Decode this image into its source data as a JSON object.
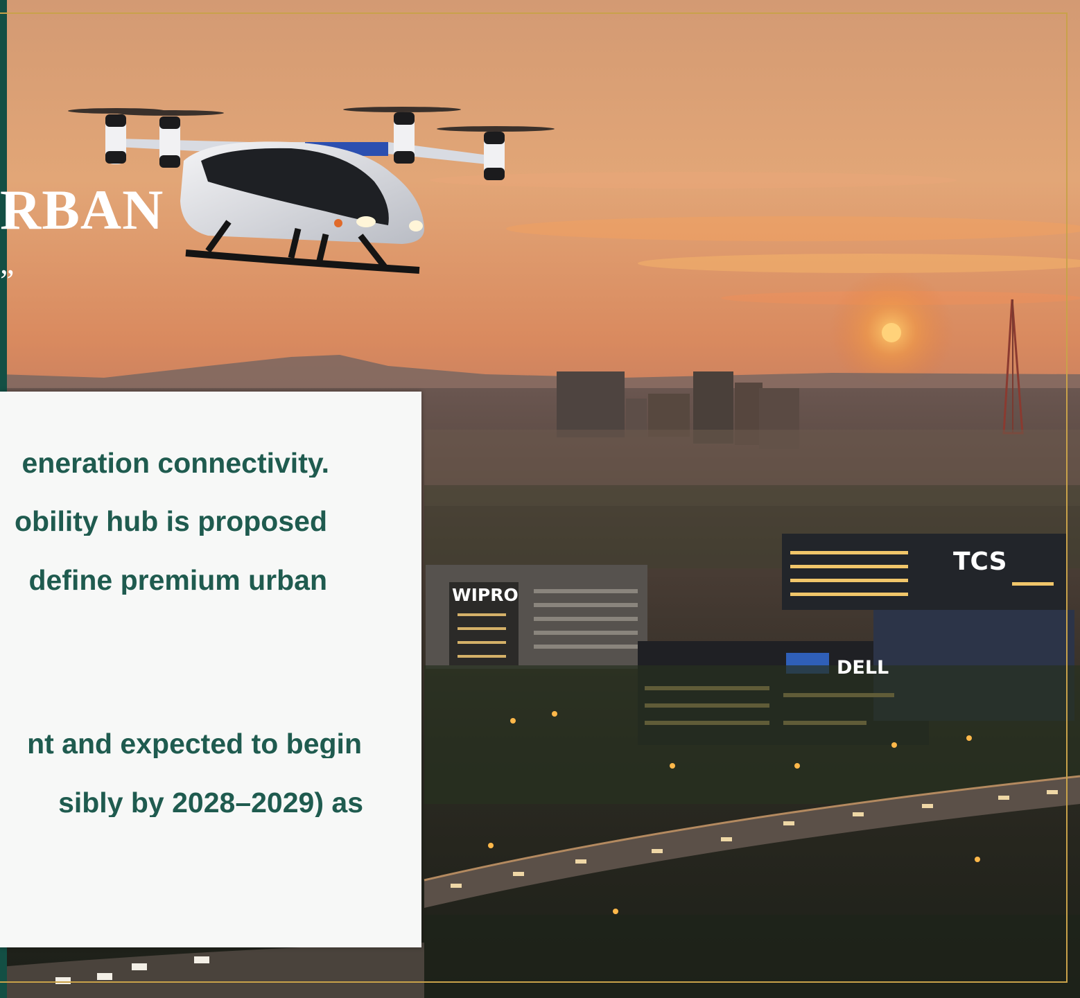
{
  "slide": {
    "title_fragment": "RBAN",
    "quote_fragment": "”",
    "card": {
      "lines": [
        "eneration connectivity.",
        "obility hub is proposed",
        "define premium urban",
        "nt and expected to begin",
        "sibly by 2028–2029) as"
      ]
    },
    "building_signs": {
      "wipro": "WIPRO",
      "tcs": "TCS",
      "dell": "DΕLL"
    }
  },
  "colors": {
    "accent_green": "#1f5b4f",
    "frame_gold": "#c9a24a",
    "strip_green": "#134f44",
    "card_background": "#f7f8f7"
  }
}
